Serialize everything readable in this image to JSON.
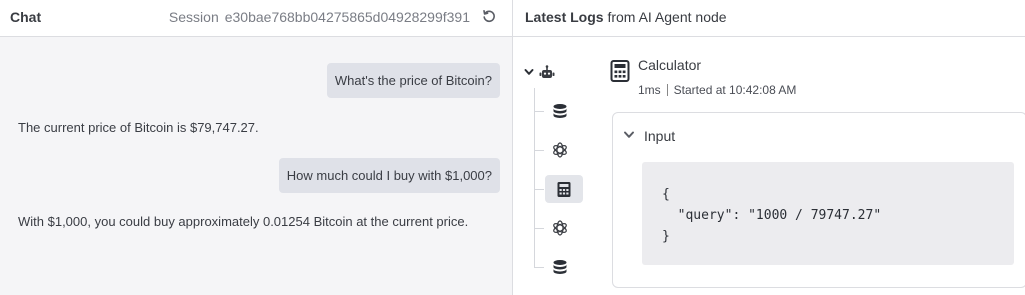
{
  "chat": {
    "title": "Chat",
    "session_label": "Session",
    "session_id": "e30bae768bb04275865d04928299f391",
    "messages": [
      {
        "role": "user",
        "text": "What's the price of Bitcoin?"
      },
      {
        "role": "bot",
        "text": "The current price of Bitcoin is $79,747.27."
      },
      {
        "role": "user",
        "text": "How much could I buy with $1,000?"
      },
      {
        "role": "bot",
        "text": "With $1,000, you could buy approximately 0.01254 Bitcoin at the current price."
      }
    ]
  },
  "logs": {
    "title_bold": "Latest Logs",
    "title_rest": " from AI Agent node",
    "tree_nodes": [
      "database-icon",
      "openai-icon",
      "calculator-icon",
      "openai-icon",
      "database-icon"
    ],
    "selected_node": "Calculator",
    "duration": "1ms",
    "started": "Started at 10:42:08 AM",
    "input_label": "Input",
    "input_code": "{\n  \"query\": \"1000 / 79747.27\"\n}"
  },
  "colors": {
    "user_bubble": "#dfe1e8",
    "chat_bg": "#f5f5f7",
    "selected_node_bg": "#e3e5ea",
    "code_bg": "#ececef"
  }
}
